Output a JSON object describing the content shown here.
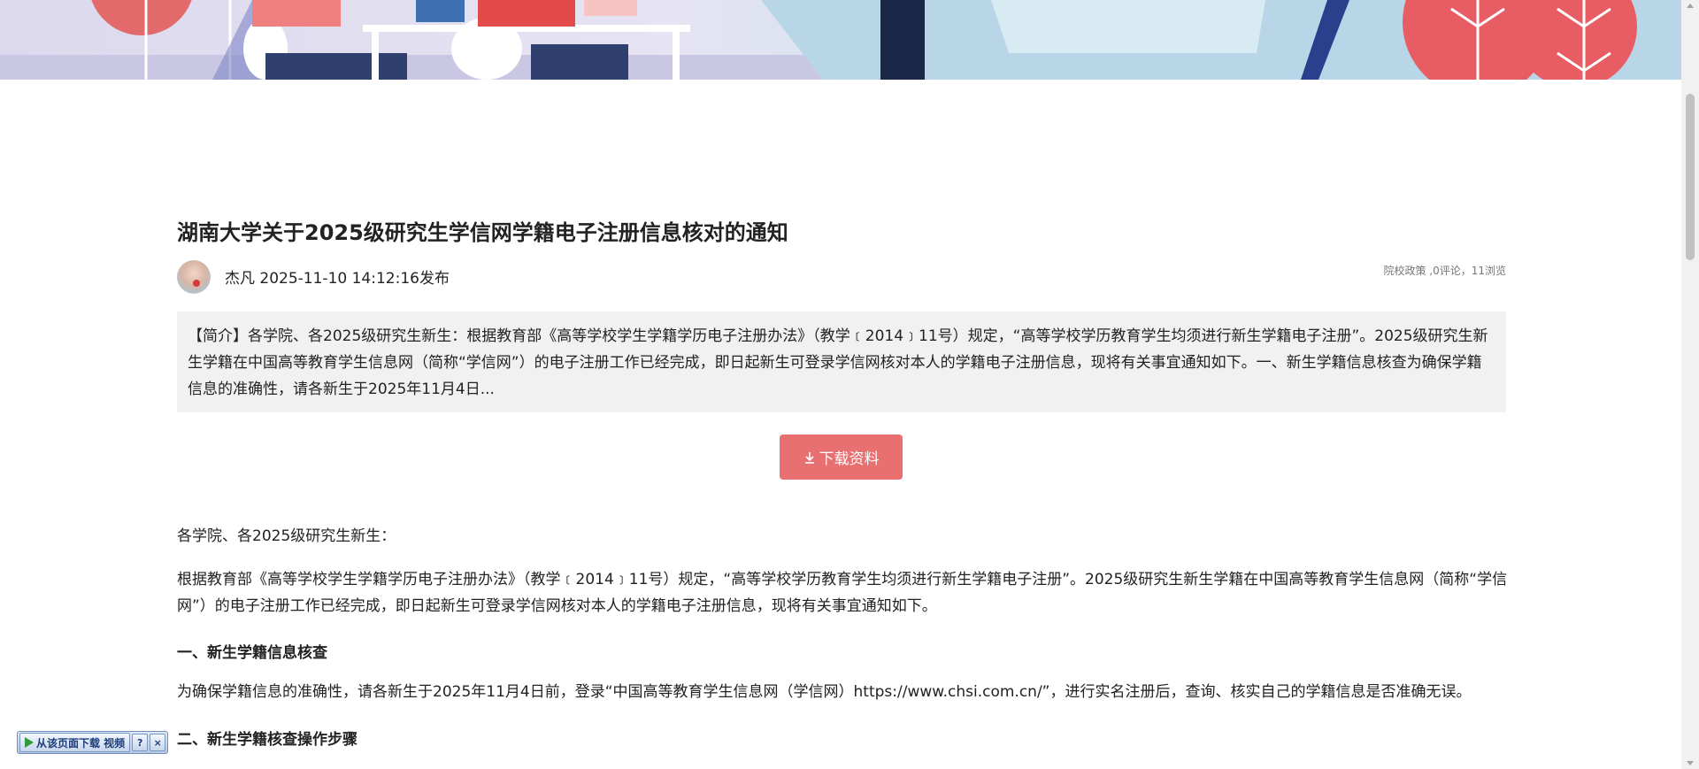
{
  "article": {
    "title": "湖南大学关于2025级研究生学信网学籍电子注册信息核对的通知",
    "author_line": "杰凡 2025-11-10 14:12:16发布",
    "meta": "院校政策 ,0评论，11浏览",
    "summary": "【简介】各学院、各2025级研究生新生：根据教育部《高等学校学生学籍学历电子注册办法》（教学﹝2014﹞11号）规定，“高等学校学历教育学生均须进行新生学籍电子注册”。2025级研究生新生学籍在中国高等教育学生信息网（简称“学信网”）的电子注册工作已经完成，即日起新生可登录学信网核对本人的学籍电子注册信息，现将有关事宜通知如下。一、新生学籍信息核查为确保学籍信息的准确性，请各新生于2025年11月4日...",
    "download_label": "下载资料",
    "body": {
      "greeting": "各学院、各2025级研究生新生：",
      "para1": "根据教育部《高等学校学生学籍学历电子注册办法》（教学﹝2014﹞11号）规定，“高等学校学历教育学生均须进行新生学籍电子注册”。2025级研究生新生学籍在中国高等教育学生信息网（简称“学信网”）的电子注册工作已经完成，即日起新生可登录学信网核对本人的学籍电子注册信息，现将有关事宜通知如下。",
      "heading1": "一、新生学籍信息核查",
      "para2": "为确保学籍信息的准确性，请各新生于2025年11月4日前，登录“中国高等教育学生信息网（学信网）https://www.chsi.com.cn/”，进行实名注册后，查询、核实自己的学籍信息是否准确无误。",
      "heading2": "二、新生学籍核查操作步骤"
    }
  },
  "video_toolbar": {
    "label": "从该页面下载 视频",
    "help": "?",
    "close": "×"
  },
  "colors": {
    "download_button": "#e87070",
    "summary_bg": "#f1f1f1"
  }
}
